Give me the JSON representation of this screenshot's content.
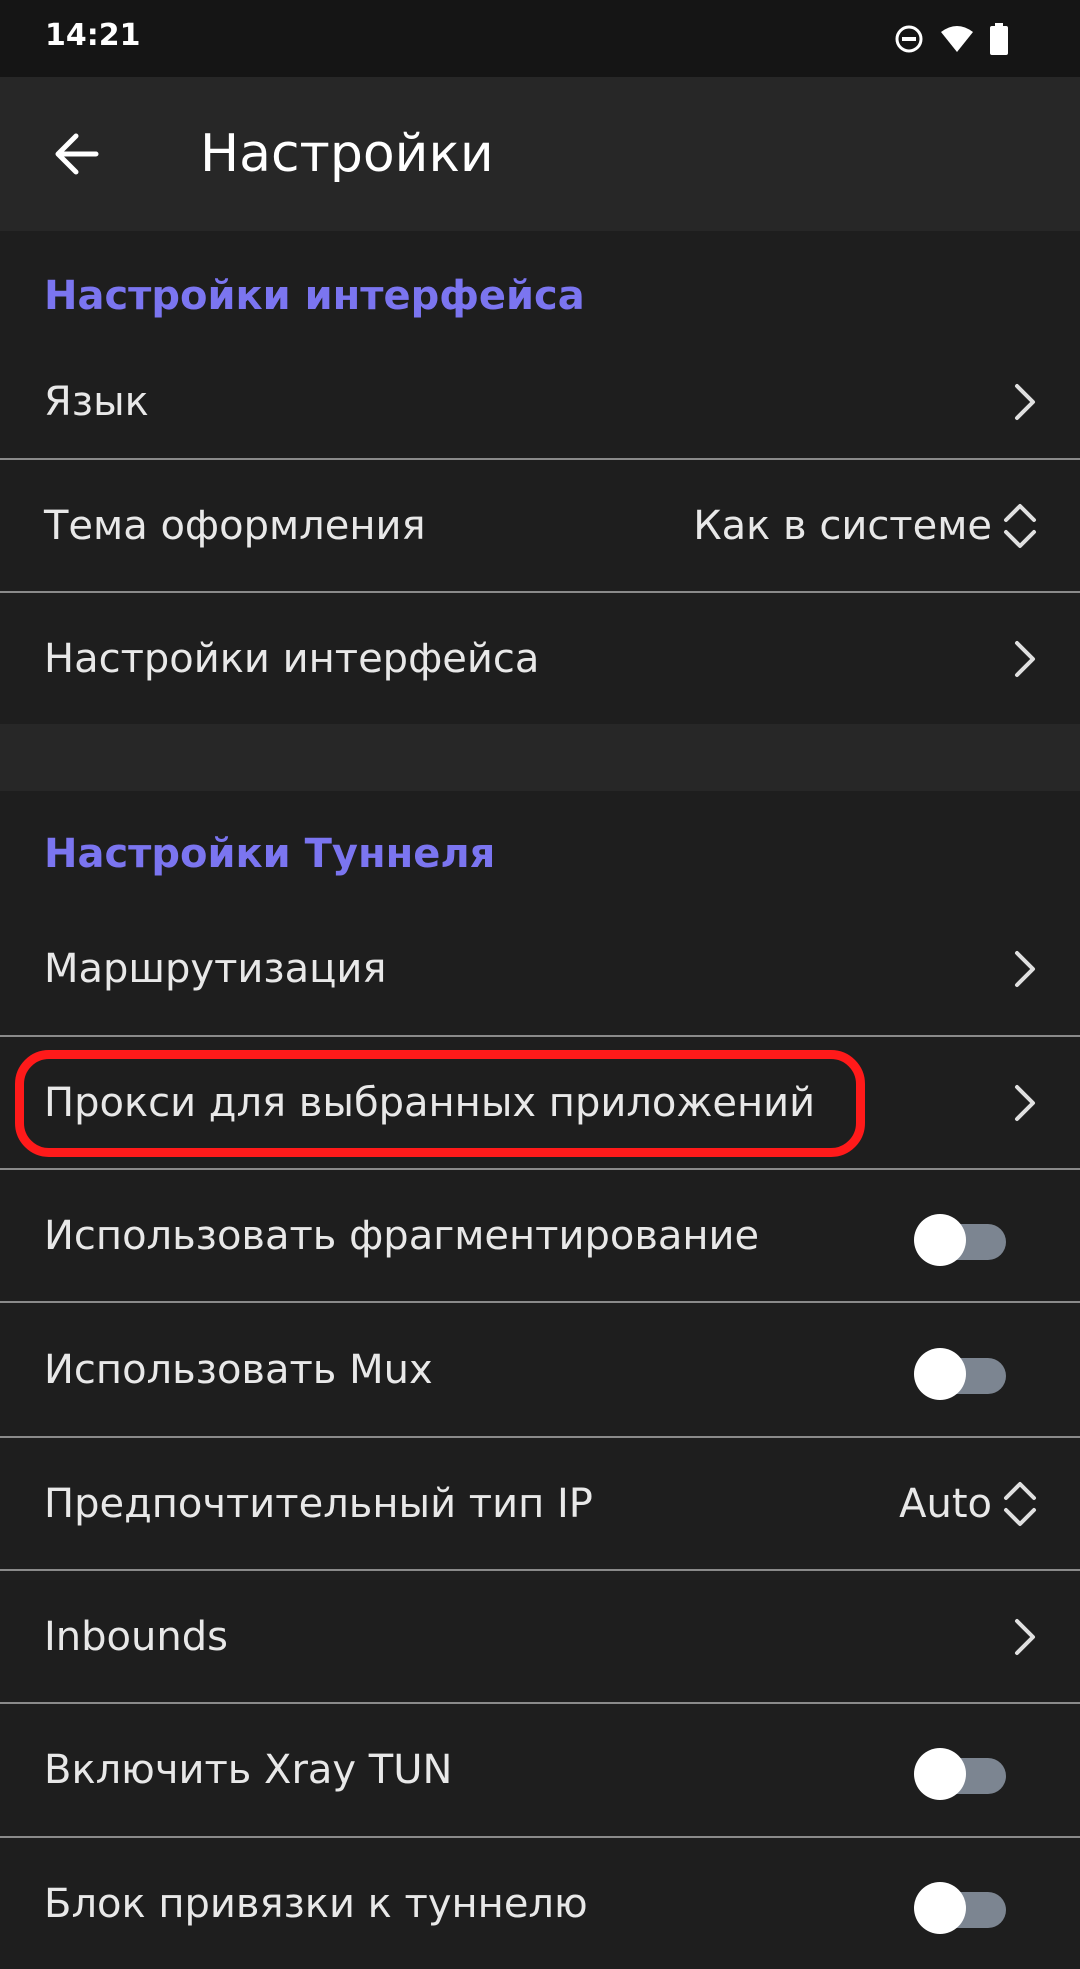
{
  "status_bar": {
    "time": "14:21",
    "icons": [
      "do-not-disturb-icon",
      "wifi-icon",
      "battery-icon"
    ]
  },
  "app_bar": {
    "title": "Настройки",
    "back_icon": "arrow-left-icon"
  },
  "sections": [
    {
      "header": "Настройки интерфейса",
      "items": [
        {
          "label": "Язык",
          "control": "chevron"
        },
        {
          "label": "Тема оформления",
          "control": "select",
          "value": "Как в системе"
        },
        {
          "label": "Настройки интерфейса",
          "control": "chevron"
        }
      ]
    },
    {
      "header": "Настройки Туннеля",
      "items": [
        {
          "label": "Маршрутизация",
          "control": "chevron"
        },
        {
          "label": "Прокси для выбранных приложений",
          "control": "chevron",
          "highlighted": true
        },
        {
          "label": "Использовать фрагментирование",
          "control": "toggle",
          "on": false
        },
        {
          "label": "Использовать Mux",
          "control": "toggle",
          "on": false
        },
        {
          "label": "Предпочтительный тип IP",
          "control": "select",
          "value": "Auto"
        },
        {
          "label": "Inbounds",
          "control": "chevron"
        },
        {
          "label": "Включить Xray TUN",
          "control": "toggle",
          "on": false
        },
        {
          "label": "Блок привязки к туннелю",
          "control": "toggle",
          "on": false
        }
      ]
    }
  ],
  "colors": {
    "accent": "#7b75f0",
    "background": "#1e1e1e",
    "app_bar": "#272727",
    "highlight": "#ff1a1a"
  }
}
